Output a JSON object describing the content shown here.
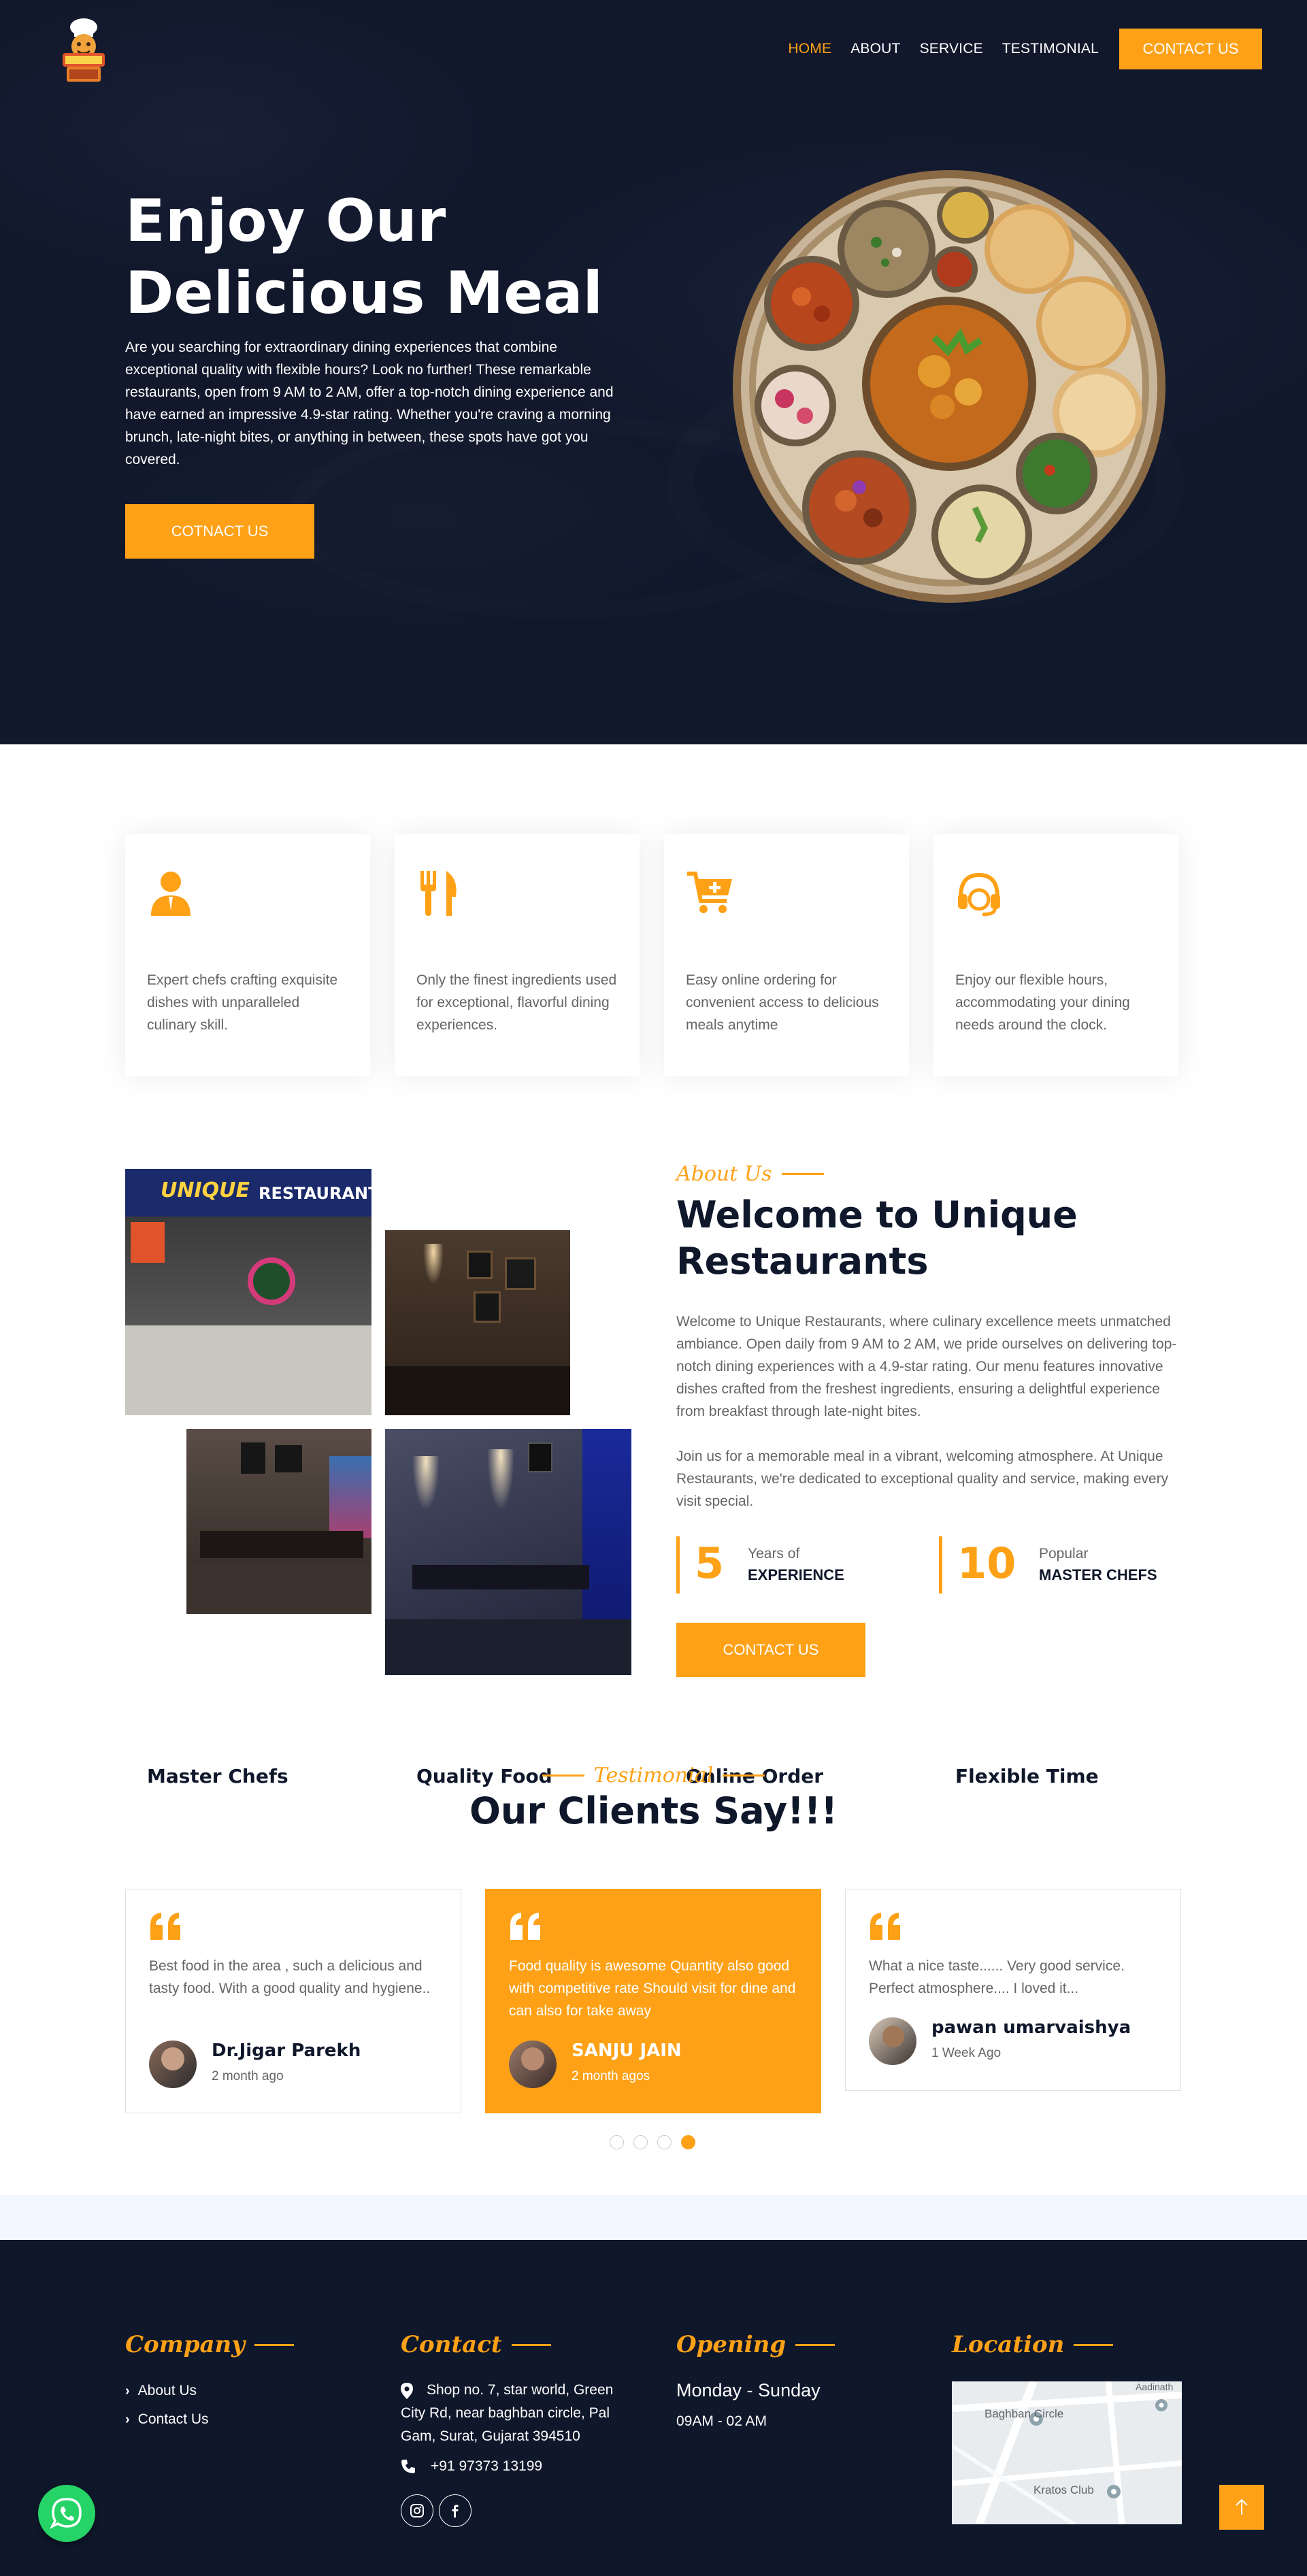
{
  "nav": {
    "items": [
      "HOME",
      "ABOUT",
      "SERVICE",
      "TESTIMONIAL"
    ],
    "contact_button": "CONTACT US"
  },
  "hero": {
    "title_line1": "Enjoy Our",
    "title_line2": "Delicious Meal",
    "text": "Are you searching for extraordinary dining experiences that combine exceptional quality with flexible hours? Look no further! These remarkable restaurants, open from 9 AM to 2 AM, offer a top-notch dining experience and have earned an impressive 4.9-star rating. Whether you're craving a morning brunch, late-night bites, or anything in between, these spots have got you covered.",
    "button": "COTNACT US"
  },
  "services": [
    {
      "title": "Master Chefs",
      "desc": "Expert chefs crafting exquisite dishes with unparalleled culinary skill.",
      "icon": "chef-icon"
    },
    {
      "title": "Quality Food",
      "desc": "Only the finest ingredients used for exceptional, flavorful dining experiences.",
      "icon": "utensils-icon"
    },
    {
      "title": "Online Order",
      "desc": "Easy online ordering for convenient access to delicious meals anytime",
      "icon": "cart-icon"
    },
    {
      "title": "Flexible Time",
      "desc": "Enjoy our flexible hours, accommodating your dining needs around the clock.",
      "icon": "headset-icon"
    }
  ],
  "about": {
    "subtitle": "About Us",
    "title": "Welcome to Unique Restaurants",
    "p1": "Welcome to Unique Restaurants, where culinary excellence meets unmatched ambiance. Open daily from 9 AM to 2 AM, we pride ourselves on delivering top-notch dining experiences with a 4.9-star rating. Our menu features innovative dishes crafted from the freshest ingredients, ensuring a delightful experience from breakfast through late-night bites.",
    "p2": "Join us for a memorable meal in a vibrant, welcoming atmosphere. At Unique Restaurants, we're dedicated to exceptional quality and service, making every visit special.",
    "stats": [
      {
        "num": "5",
        "small": "Years of",
        "big": "EXPERIENCE"
      },
      {
        "num": "10",
        "small": "Popular",
        "big": "MASTER CHEFS"
      }
    ],
    "button": "CONTACT US",
    "sign_text": "UNIQUE",
    "sign_text2": "RESTAURANT"
  },
  "testimonials": {
    "subtitle": "Testimonial",
    "title": "Our Clients Say!!!",
    "items": [
      {
        "text": "Best food in the area , such a delicious and tasty food. With a good quality and hygiene..",
        "name": "Dr.Jigar Parekh",
        "when": "2 month ago"
      },
      {
        "text": "Food quality is awesome Quantity also good with competitive rate Should visit for dine and can also for take away",
        "name": "SANJU JAIN",
        "when": "2 month agos"
      },
      {
        "text": "What a nice taste...... Very good service. Perfect atmosphere.... I loved it...",
        "name": "pawan umarvaishya",
        "when": "1 Week Ago"
      }
    ],
    "active_dot": 3
  },
  "footer": {
    "company": {
      "title": "Company",
      "links": [
        "About Us",
        "Contact Us"
      ]
    },
    "contact": {
      "title": "Contact",
      "address": "Shop no. 7, star world, Green City Rd, near baghban circle, Pal Gam, Surat, Gujarat 394510",
      "phone": "+91 97373 13199"
    },
    "opening": {
      "title": "Opening",
      "days": "Monday - Sunday",
      "hours": "09AM - 02 AM"
    },
    "location": {
      "title": "Location",
      "map_labels": [
        "Baghban Circle",
        "Kratos Club",
        "Aadinath"
      ]
    }
  },
  "colors": {
    "accent": "#fea116",
    "dark": "#0f172b",
    "muted": "#666565",
    "whatsapp": "#25d366"
  }
}
